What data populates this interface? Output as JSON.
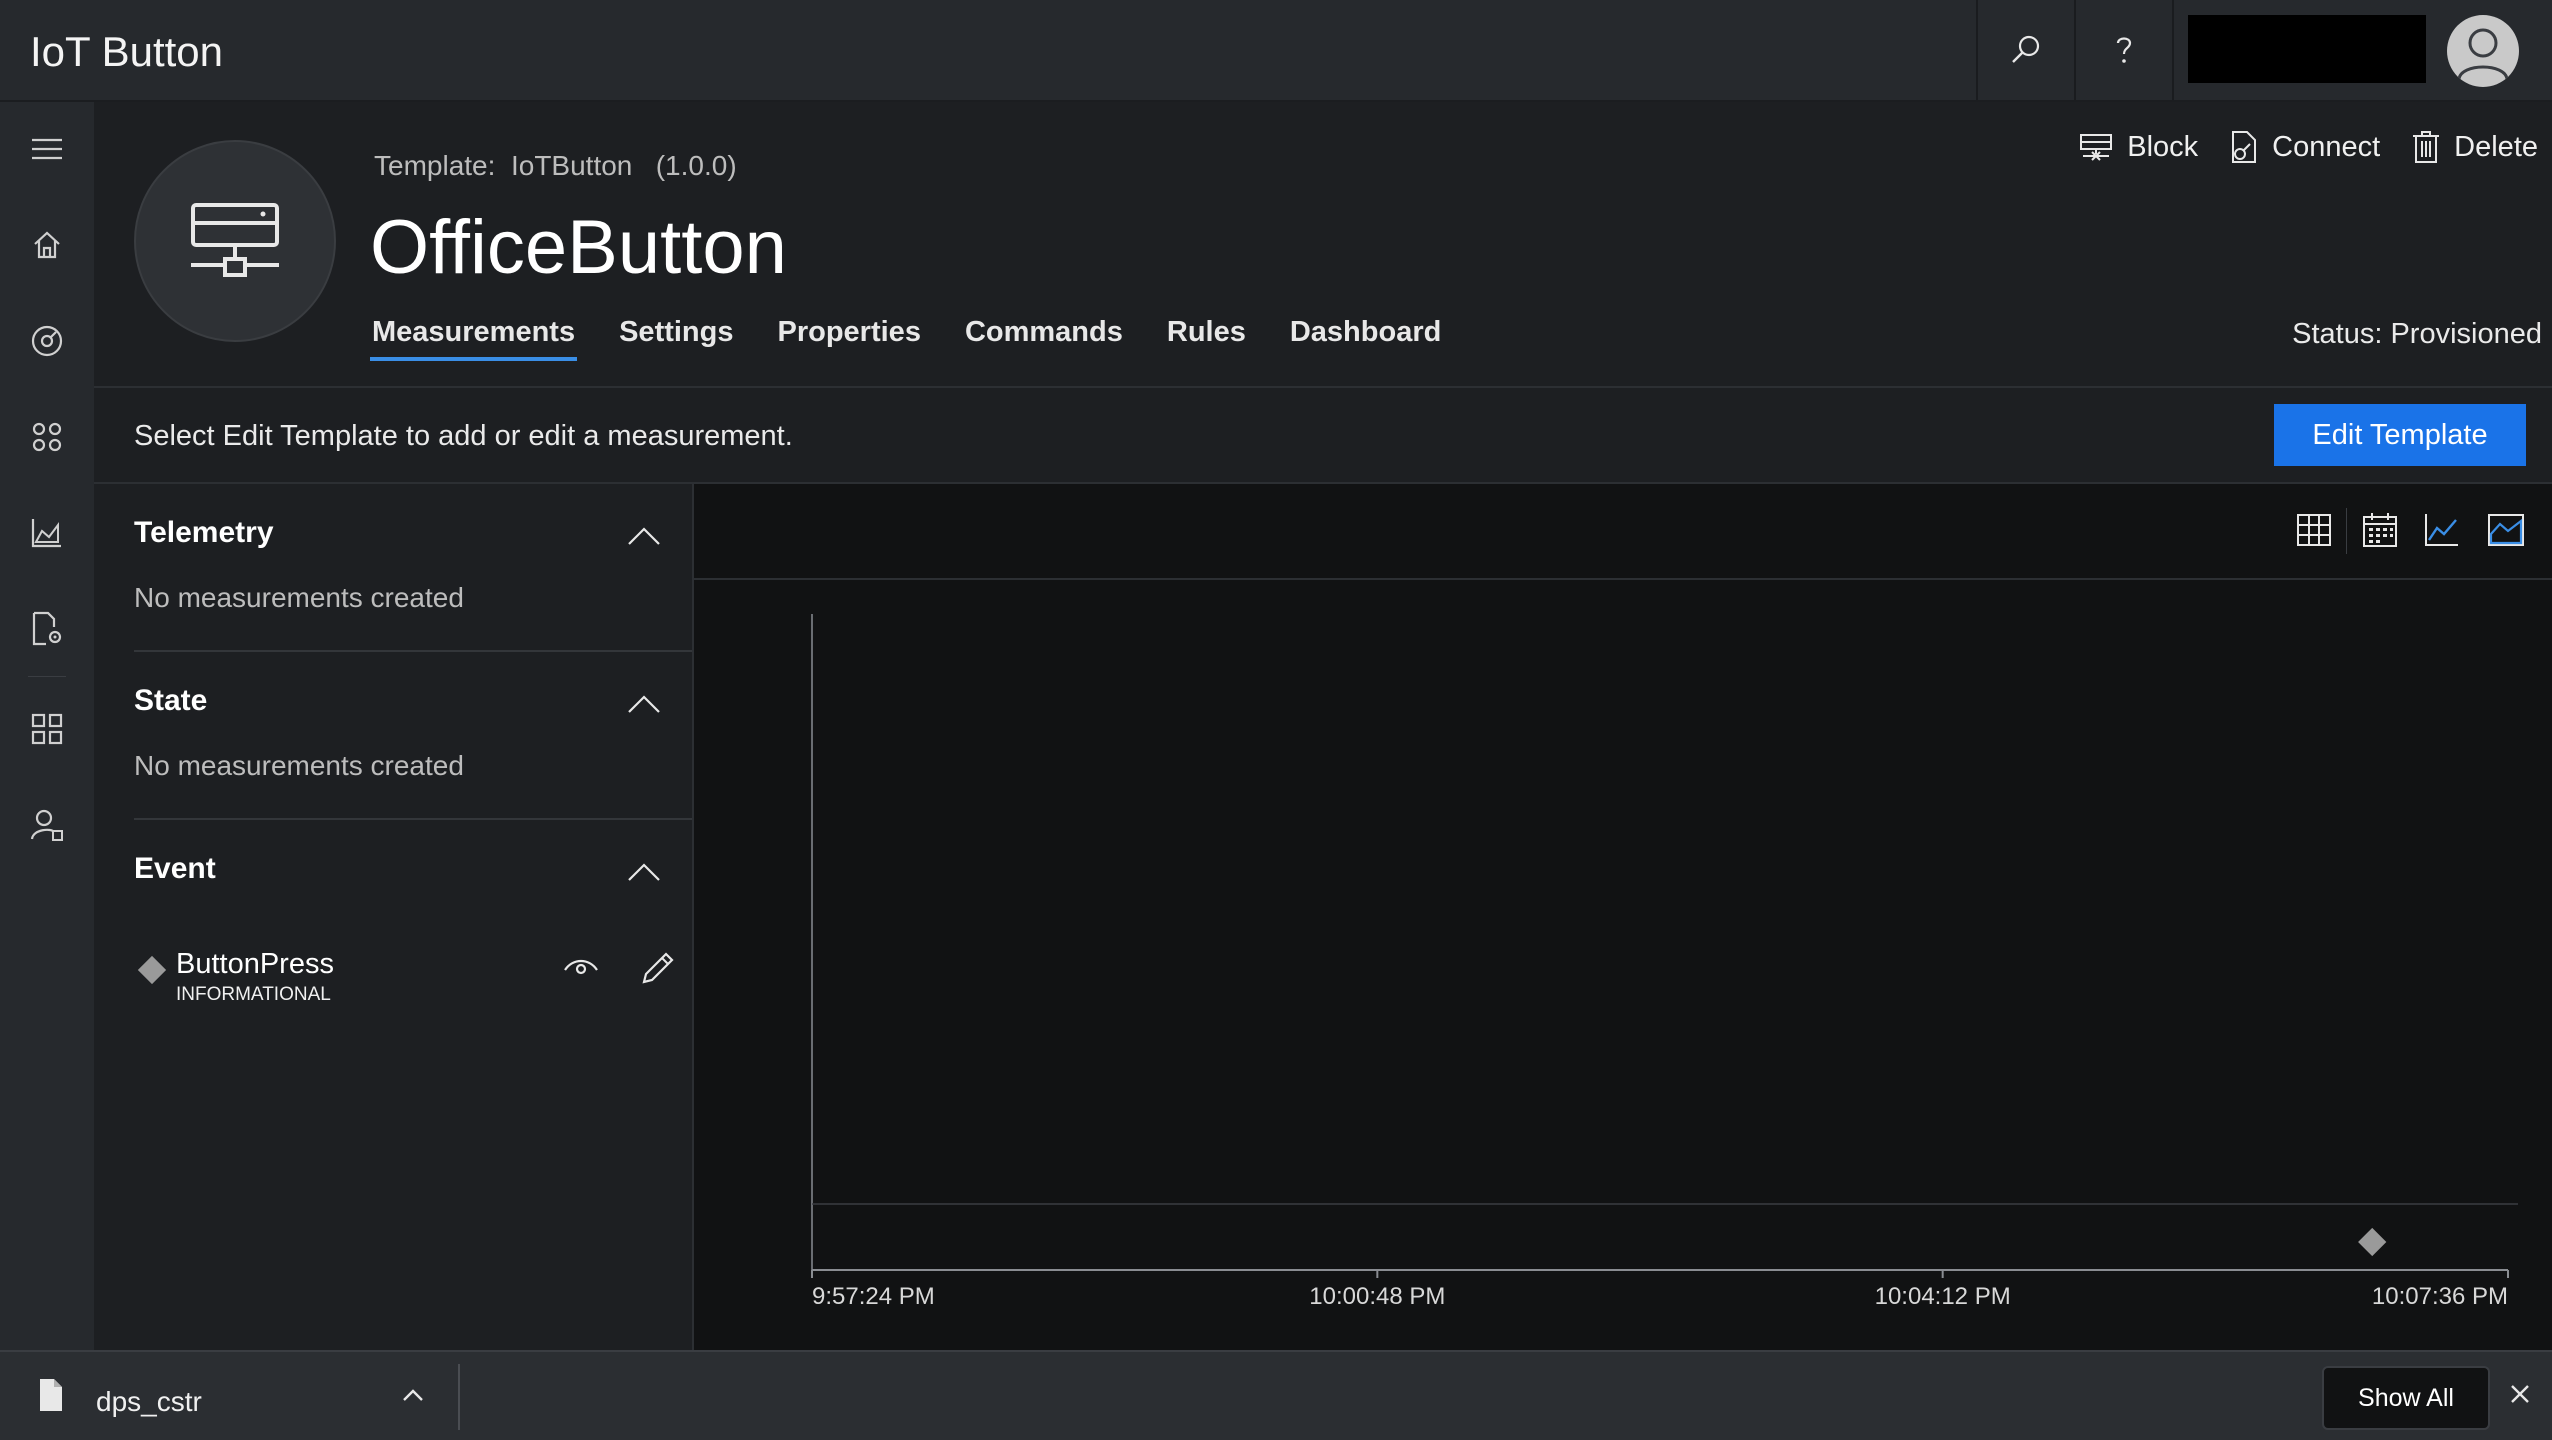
{
  "app": {
    "title": "IoT Button"
  },
  "device": {
    "template_label": "Template:",
    "template_name": "IoTButton",
    "template_version": "(1.0.0)",
    "name": "OfficeButton",
    "status": "Status: Provisioned"
  },
  "tabs": [
    {
      "label": "Measurements",
      "active": true
    },
    {
      "label": "Settings",
      "active": false
    },
    {
      "label": "Properties",
      "active": false
    },
    {
      "label": "Commands",
      "active": false
    },
    {
      "label": "Rules",
      "active": false
    },
    {
      "label": "Dashboard",
      "active": false
    }
  ],
  "actions": {
    "block": "Block",
    "connect": "Connect",
    "delete": "Delete"
  },
  "infobar": {
    "text": "Select Edit Template to add or edit a measurement.",
    "edit_button": "Edit Template"
  },
  "sections": {
    "telemetry": {
      "title": "Telemetry",
      "empty": "No measurements created"
    },
    "state": {
      "title": "State",
      "empty": "No measurements created"
    },
    "event": {
      "title": "Event",
      "items": [
        {
          "name": "ButtonPress",
          "severity": "INFORMATIONAL"
        }
      ]
    }
  },
  "chart_data": {
    "type": "scatter",
    "x_tick_labels": [
      "9:57:24 PM",
      "10:00:48 PM",
      "10:04:12 PM",
      "10:07:36 PM"
    ],
    "series": [
      {
        "name": "ButtonPress",
        "marker": "diamond",
        "x_times": [
          "10:06:47 PM"
        ]
      }
    ]
  },
  "download": {
    "file_name": "dps_cstr",
    "show_all": "Show All"
  },
  "colors": {
    "accent": "#1a73e8",
    "tab_underline": "#3a8ee6",
    "background": "#111213",
    "panel": "#1d1f22",
    "marker": "#9a9a9a"
  },
  "icons": {
    "top": [
      "search-icon",
      "help-icon",
      "user-avatar-icon"
    ],
    "nav": [
      "hamburger-icon",
      "home-icon",
      "device-explorer-icon",
      "device-sets-icon",
      "analytics-icon",
      "jobs-icon",
      "app-builder-icon",
      "admin-icon"
    ],
    "chart_toolbar": [
      "grid-view-icon",
      "calendar-icon",
      "line-chart-icon",
      "area-chart-icon"
    ]
  }
}
